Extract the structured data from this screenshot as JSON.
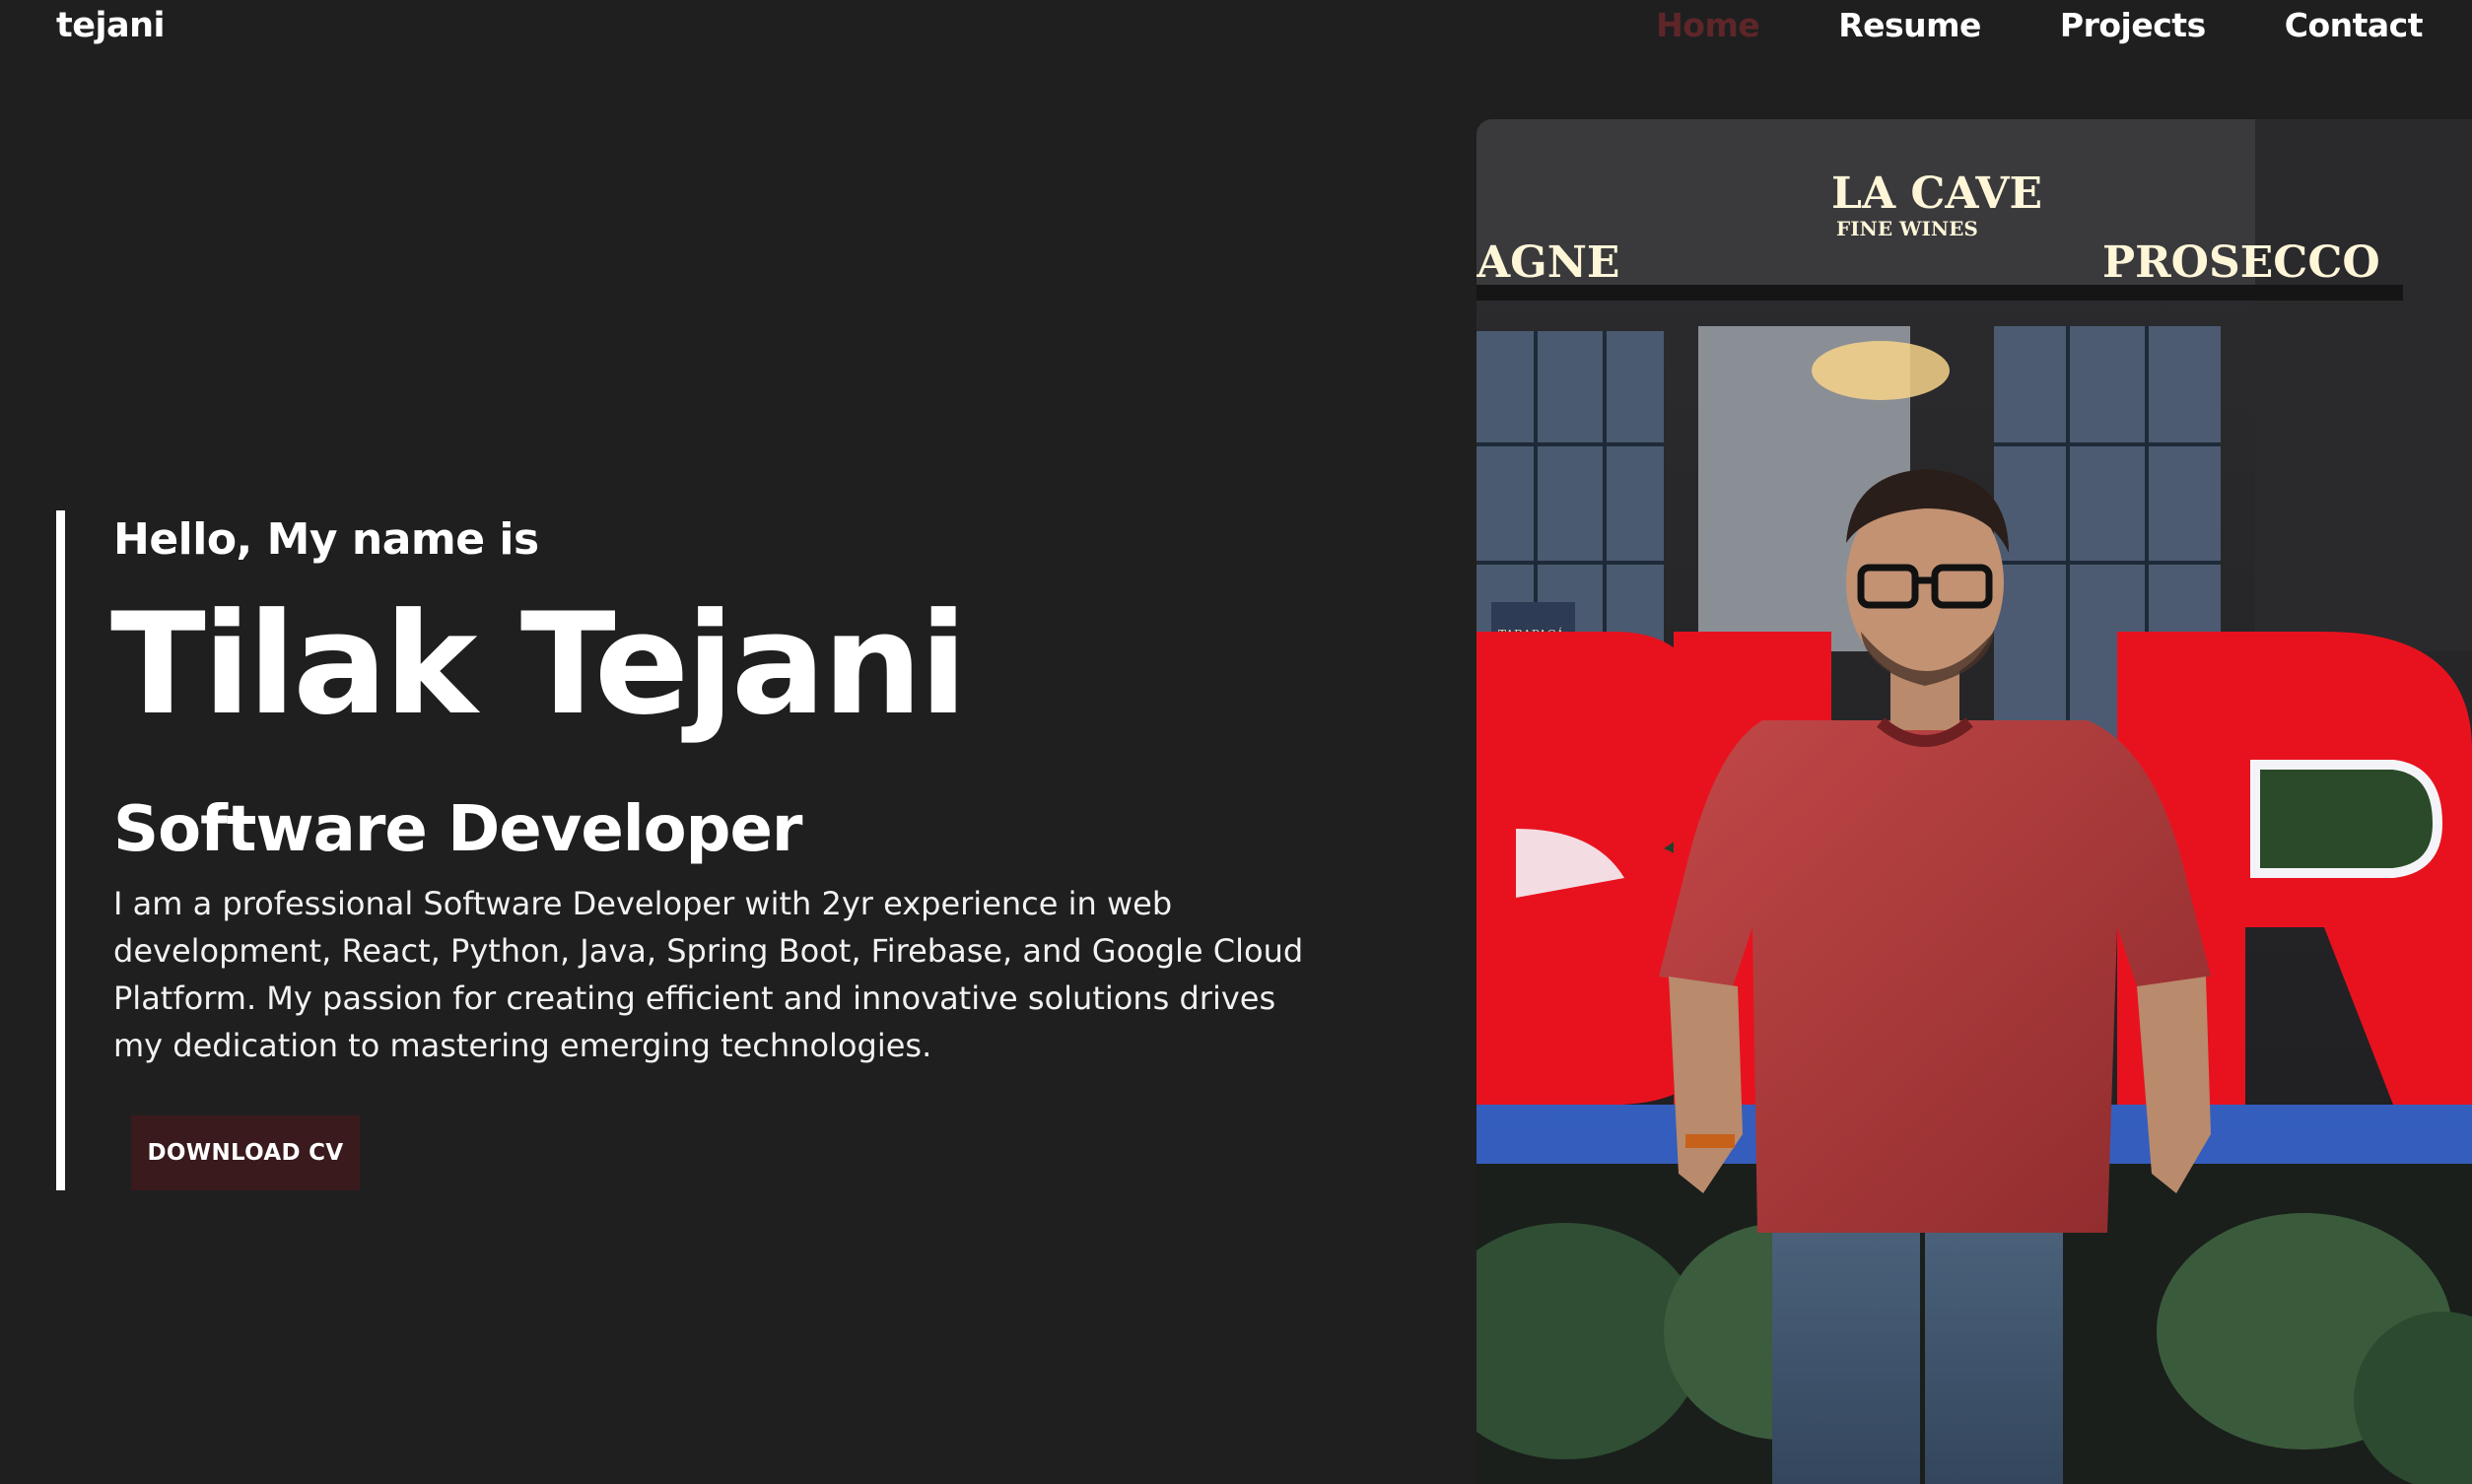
{
  "nav": {
    "logo": "tejani",
    "items": [
      {
        "label": "Home",
        "active": true
      },
      {
        "label": "Resume",
        "active": false
      },
      {
        "label": "Projects",
        "active": false
      },
      {
        "label": "Contact",
        "active": false
      }
    ]
  },
  "hero": {
    "greeting": "Hello, My name is",
    "name": "Tilak Tejani",
    "role": "Software Developer",
    "bio": "I am a professional Software Developer with 2yr experience in web development, React, Python, Java, Spring Boot, Firebase, and Google Cloud Platform. My passion for creating efficient and innovative solutions drives my dedication to mastering emerging technologies.",
    "cta_label": "DOWNLOAD CV"
  },
  "photo": {
    "sign_main": "LA CAVE",
    "sign_sub": "FINE WINES",
    "sign_left": "AGNE",
    "sign_right": "PROSECCO",
    "sign_small": "TARAPACÁ"
  },
  "colors": {
    "background": "#1f1f20",
    "nav_active": "#5e2629",
    "cta_background": "#3a1a1c",
    "accent_red": "#e8121e"
  }
}
